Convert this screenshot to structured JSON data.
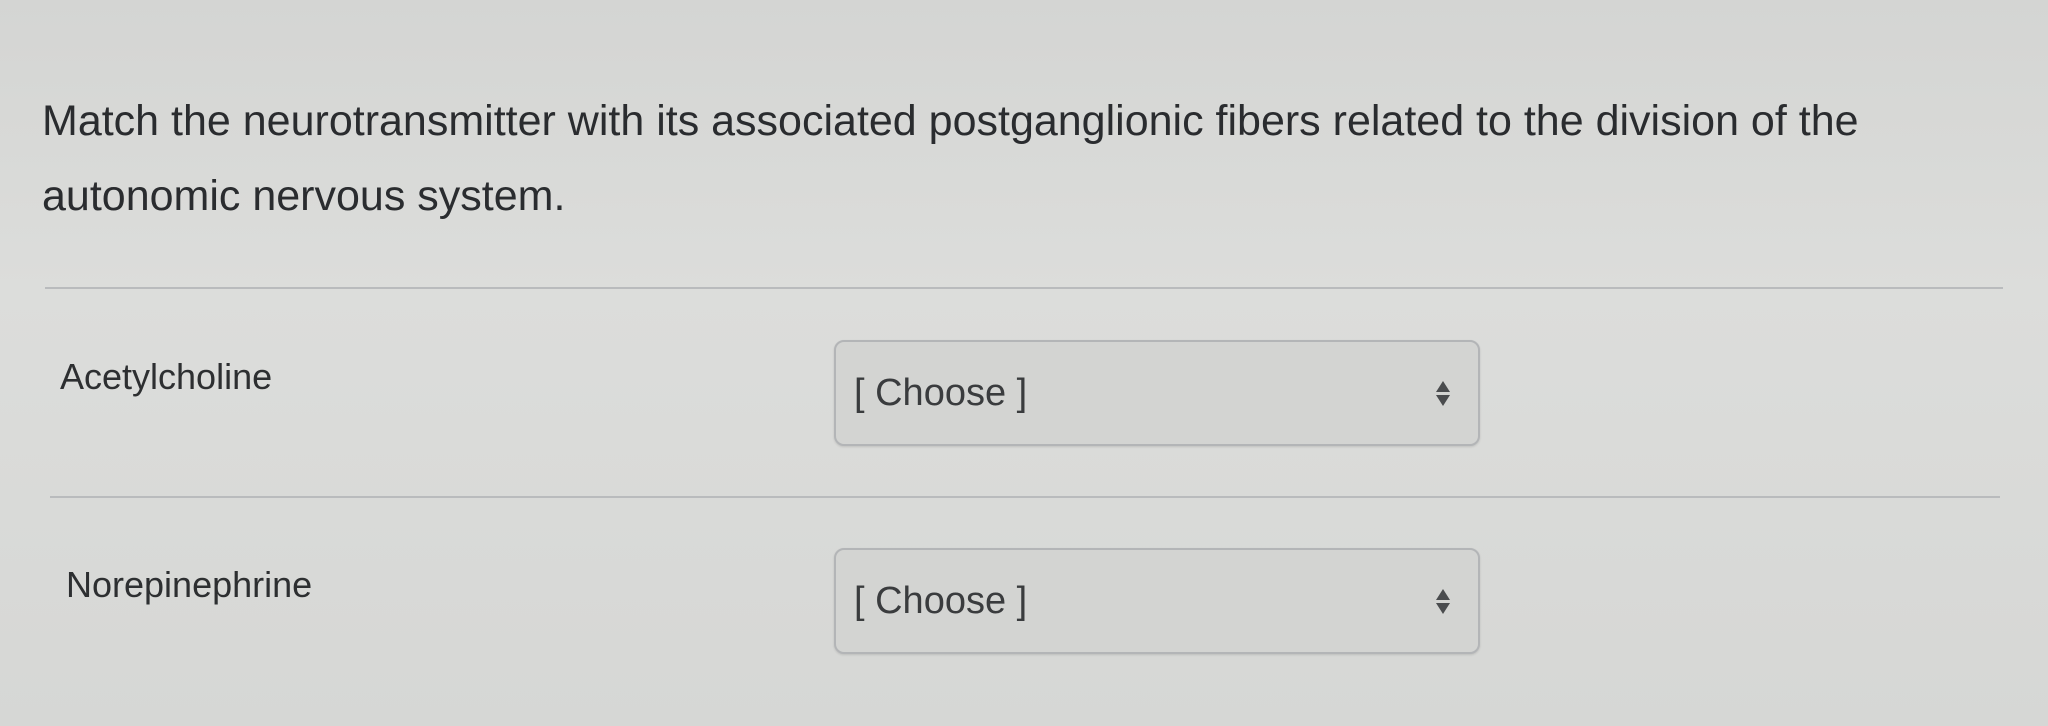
{
  "question": {
    "text": "Match the neurotransmitter with its associated postganglionic fibers related to the division of the autonomic nervous system."
  },
  "matches": [
    {
      "label": "Acetylcholine",
      "selected": "[ Choose ]"
    },
    {
      "label": "Norepinephrine",
      "selected": "[ Choose ]"
    }
  ],
  "icons": {
    "select_arrow": "up-down-arrows-icon"
  },
  "colors": {
    "background": "#d9dad8",
    "text": "#2a2c2f",
    "select_background": "#d3d4d2",
    "select_border": "#b3b5b7",
    "divider": "#b9bbbd"
  }
}
